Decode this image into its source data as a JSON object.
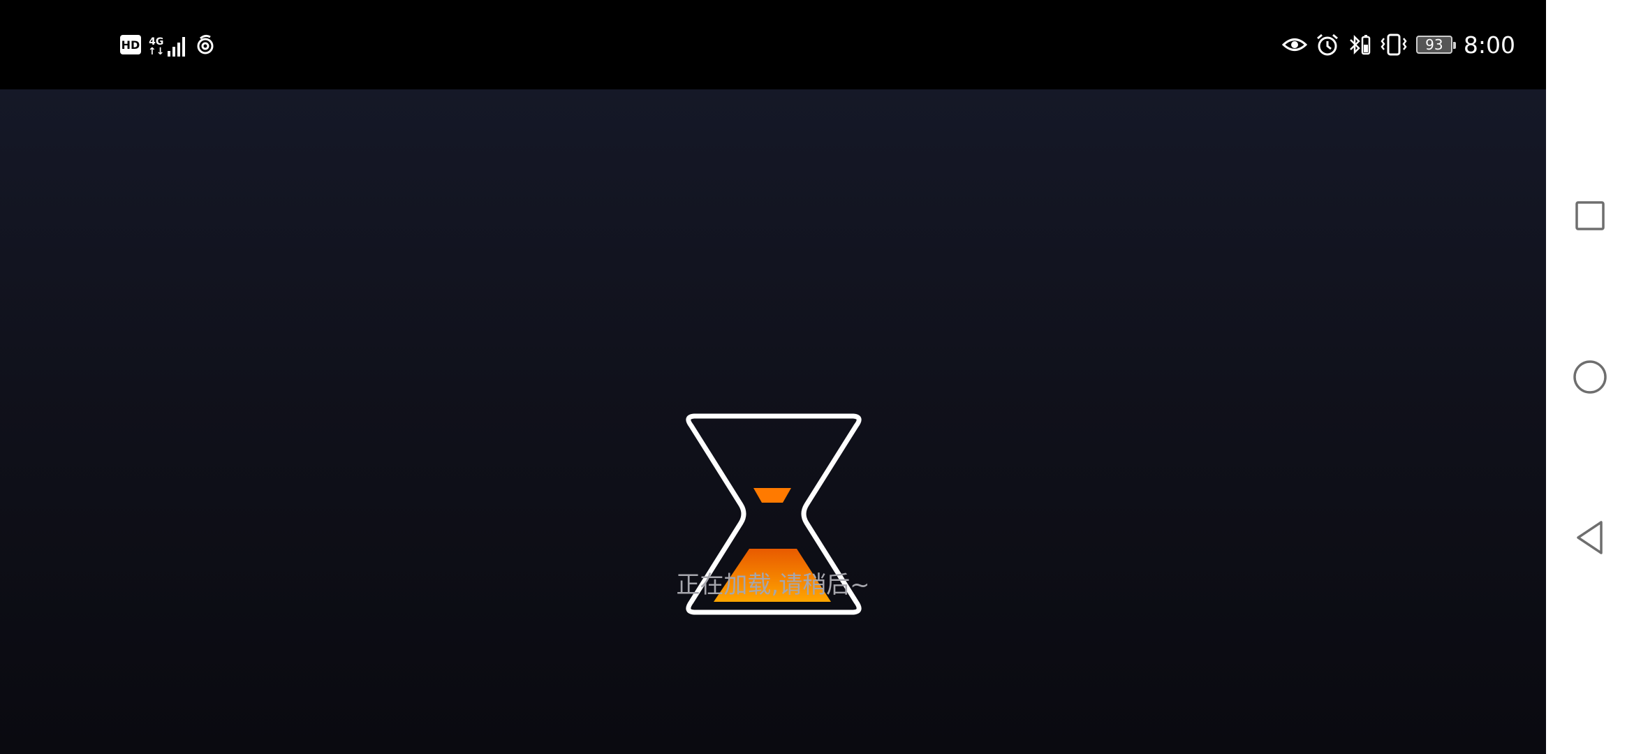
{
  "status_bar": {
    "hd_badge": "HD",
    "network_type": "4G",
    "network_arrows": "↑↓",
    "battery_level": "93",
    "time": "8:00",
    "icons": [
      "hd-icon",
      "signal-4g-icon",
      "hotspot-icon",
      "eye-comfort-icon",
      "alarm-icon",
      "bluetooth-battery-icon",
      "vibrate-icon",
      "battery-icon"
    ]
  },
  "main": {
    "loading_text": "正在加载,请稍后~",
    "loading_icon": "hourglass-icon",
    "sand_color": "#ff8a00",
    "sand_color_dark": "#e85a00"
  },
  "nav_bar": {
    "buttons": [
      "recent-apps-button",
      "home-button",
      "back-button"
    ]
  }
}
